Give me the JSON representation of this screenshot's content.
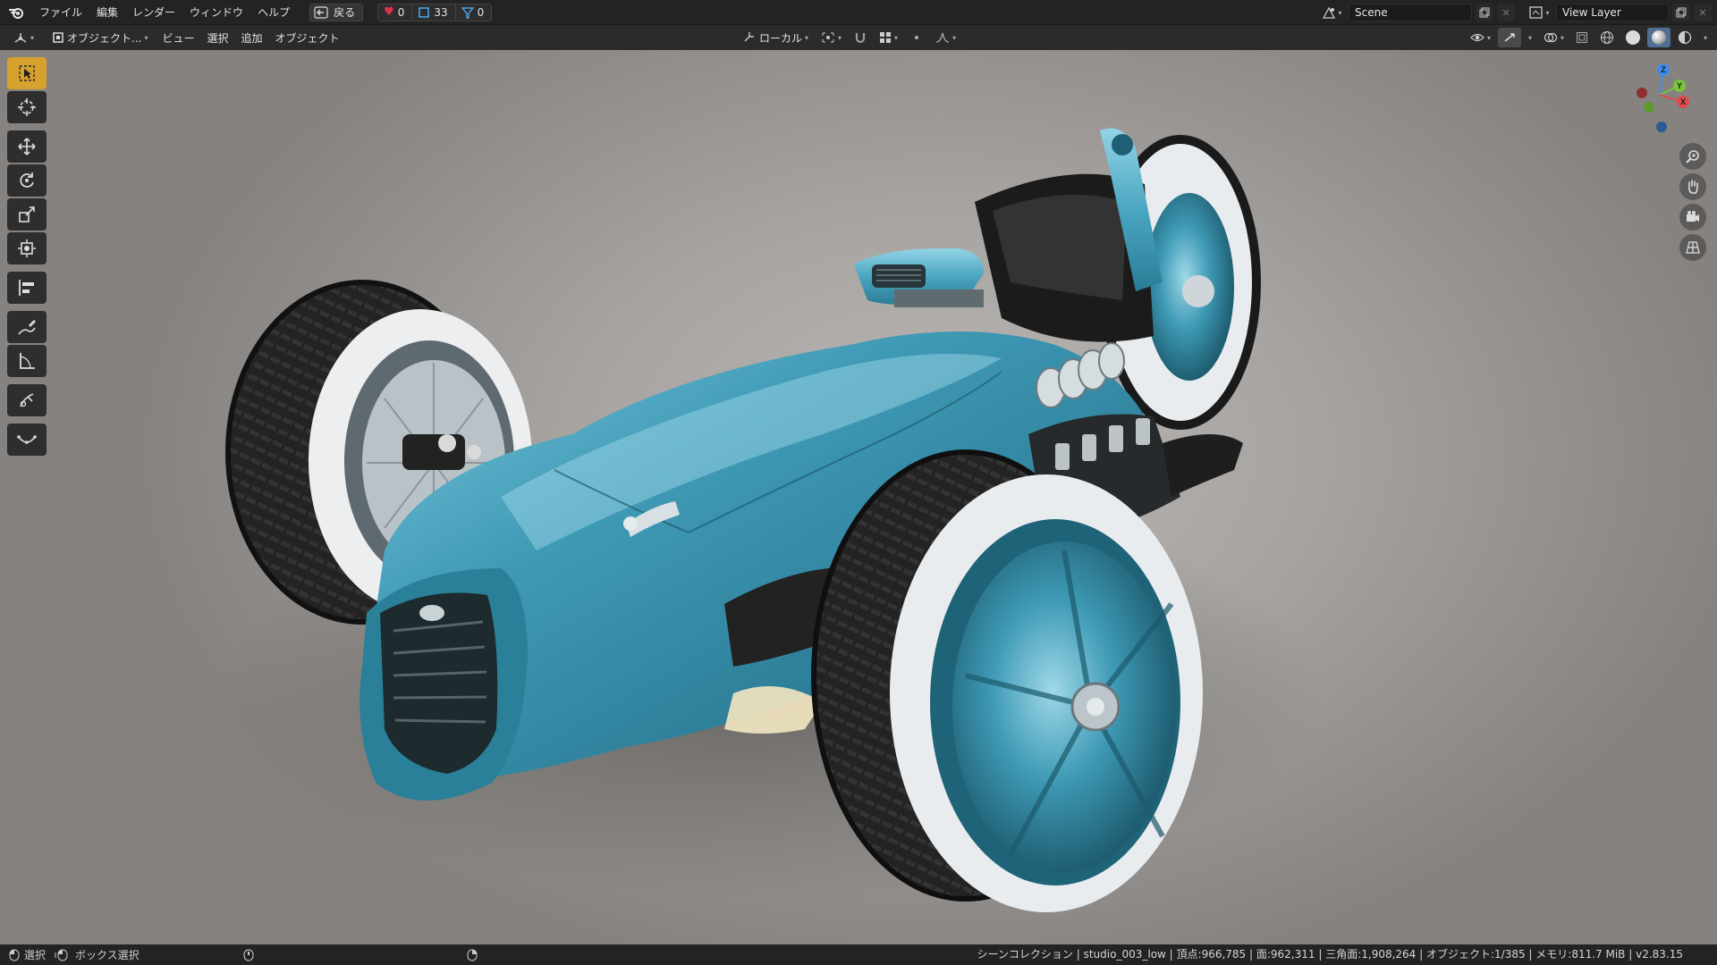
{
  "topbar": {
    "menu": [
      "ファイル",
      "編集",
      "レンダー",
      "ウィンドウ",
      "ヘルプ"
    ],
    "back_label": "戻る",
    "stats": {
      "hearts": "0",
      "objects": "33",
      "filter": "0"
    },
    "scene_name": "Scene",
    "view_layer_name": "View Layer"
  },
  "header": {
    "mode_label": "オブジェクト...",
    "view_label": "ビュー",
    "select_label": "選択",
    "add_label": "追加",
    "object_label": "オブジェクト",
    "transform_orientation": "ローカル"
  },
  "toolbar": {
    "tools": [
      "select-box",
      "cursor",
      "move",
      "rotate",
      "scale",
      "transform",
      "align",
      "annotate",
      "measure",
      "shear",
      "curve"
    ],
    "active": "select-box"
  },
  "statusbar": {
    "select_label": "選択",
    "box_select_label": "ボックス選択",
    "info": "シーンコレクション | studio_003_low | 頂点:966,785 | 面:962,311 | 三角面:1,908,264 | オブジェクト:1/385 | メモリ:811.7 MiB | v2.83.15"
  },
  "colors": {
    "accent": "#d6a12c",
    "car_body": "#3e9ab5",
    "axis_x": "#e04a4a",
    "axis_y": "#7ac53b",
    "axis_z": "#3d8ce8"
  }
}
